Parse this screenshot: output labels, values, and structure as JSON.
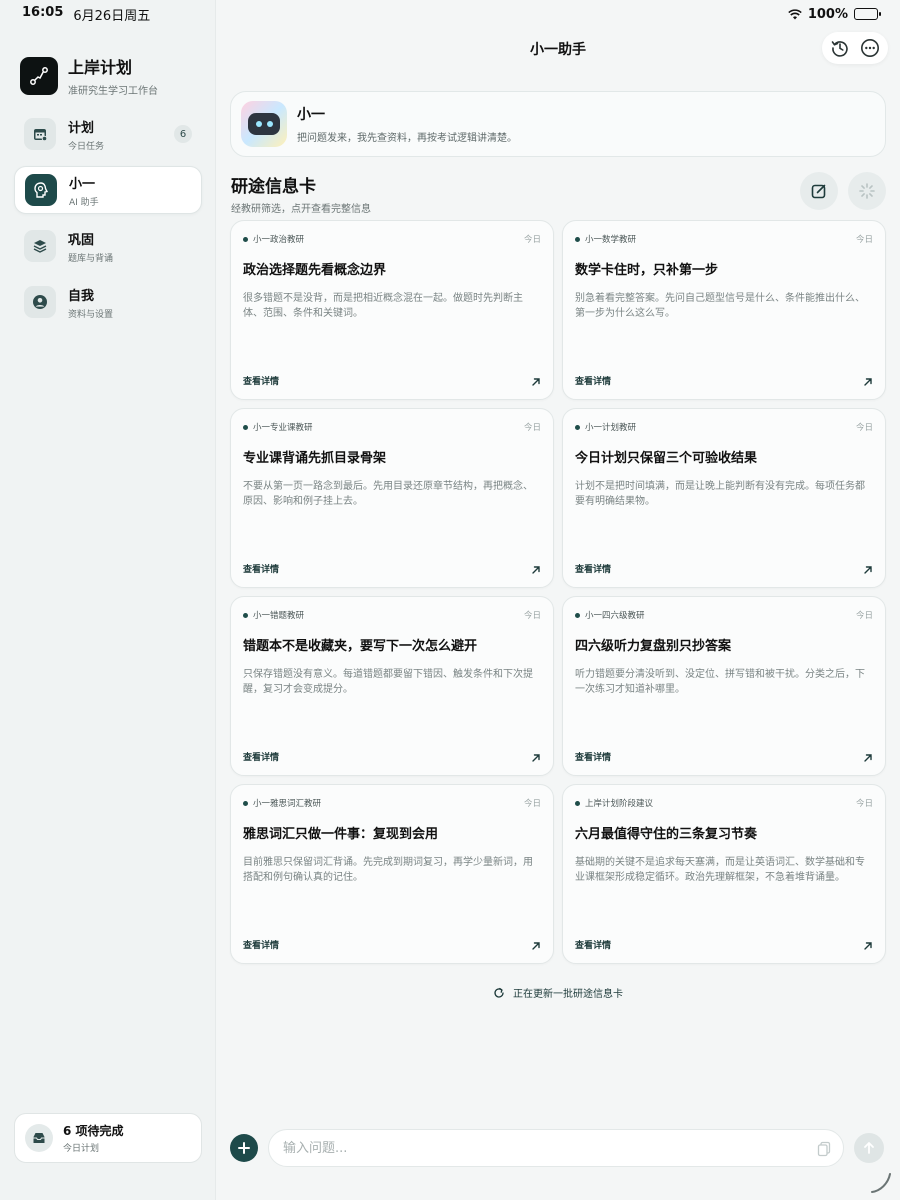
{
  "status": {
    "time": "16:05",
    "date": "6月26日周五",
    "battery": "100%"
  },
  "sidebar": {
    "brand_title": "上岸计划",
    "brand_sub": "准研究生学习工作台",
    "items": [
      {
        "label": "计划",
        "sub": "今日任务",
        "badge": "6"
      },
      {
        "label": "小一",
        "sub": "AI 助手"
      },
      {
        "label": "巩固",
        "sub": "题库与背诵"
      },
      {
        "label": "自我",
        "sub": "资料与设置"
      }
    ],
    "pending_title": "6 项待完成",
    "pending_sub": "今日计划"
  },
  "header": {
    "title": "小一助手"
  },
  "assistant": {
    "name": "小一",
    "desc": "把问题发来，我先查资料，再按考试逻辑讲清楚。"
  },
  "section": {
    "title": "研途信息卡",
    "sub": "经教研筛选，点开查看完整信息"
  },
  "cards": [
    {
      "tag": "小一政治教研",
      "date": "今日",
      "title": "政治选择题先看概念边界",
      "body": "很多错题不是没背，而是把相近概念混在一起。做题时先判断主体、范围、条件和关键词。",
      "link": "查看详情"
    },
    {
      "tag": "小一数学教研",
      "date": "今日",
      "title": "数学卡住时，只补第一步",
      "body": "别急着看完整答案。先问自己题型信号是什么、条件能推出什么、第一步为什么这么写。",
      "link": "查看详情"
    },
    {
      "tag": "小一专业课教研",
      "date": "今日",
      "title": "专业课背诵先抓目录骨架",
      "body": "不要从第一页一路念到最后。先用目录还原章节结构，再把概念、原因、影响和例子挂上去。",
      "link": "查看详情"
    },
    {
      "tag": "小一计划教研",
      "date": "今日",
      "title": "今日计划只保留三个可验收结果",
      "body": "计划不是把时间填满，而是让晚上能判断有没有完成。每项任务都要有明确结果物。",
      "link": "查看详情"
    },
    {
      "tag": "小一错题教研",
      "date": "今日",
      "title": "错题本不是收藏夹，要写下一次怎么避开",
      "body": "只保存错题没有意义。每道错题都要留下错因、触发条件和下次提醒，复习才会变成提分。",
      "link": "查看详情"
    },
    {
      "tag": "小一四六级教研",
      "date": "今日",
      "title": "四六级听力复盘别只抄答案",
      "body": "听力错题要分清没听到、没定位、拼写错和被干扰。分类之后，下一次练习才知道补哪里。",
      "link": "查看详情"
    },
    {
      "tag": "小一雅思词汇教研",
      "date": "今日",
      "title": "雅思词汇只做一件事：复现到会用",
      "body": "目前雅思只保留词汇背诵。先完成到期词复习，再学少量新词，用搭配和例句确认真的记住。",
      "link": "查看详情"
    },
    {
      "tag": "上岸计划阶段建议",
      "date": "今日",
      "title": "六月最值得守住的三条复习节奏",
      "body": "基础期的关键不是追求每天塞满，而是让英语词汇、数学基础和专业课框架形成稳定循环。政治先理解框架，不急着堆背诵量。",
      "link": "查看详情"
    }
  ],
  "refresh_text": "正在更新一批研途信息卡",
  "composer": {
    "placeholder": "输入问题..."
  },
  "colors": {
    "accent": "#1e4a4a",
    "background": "#f4f6f6"
  }
}
